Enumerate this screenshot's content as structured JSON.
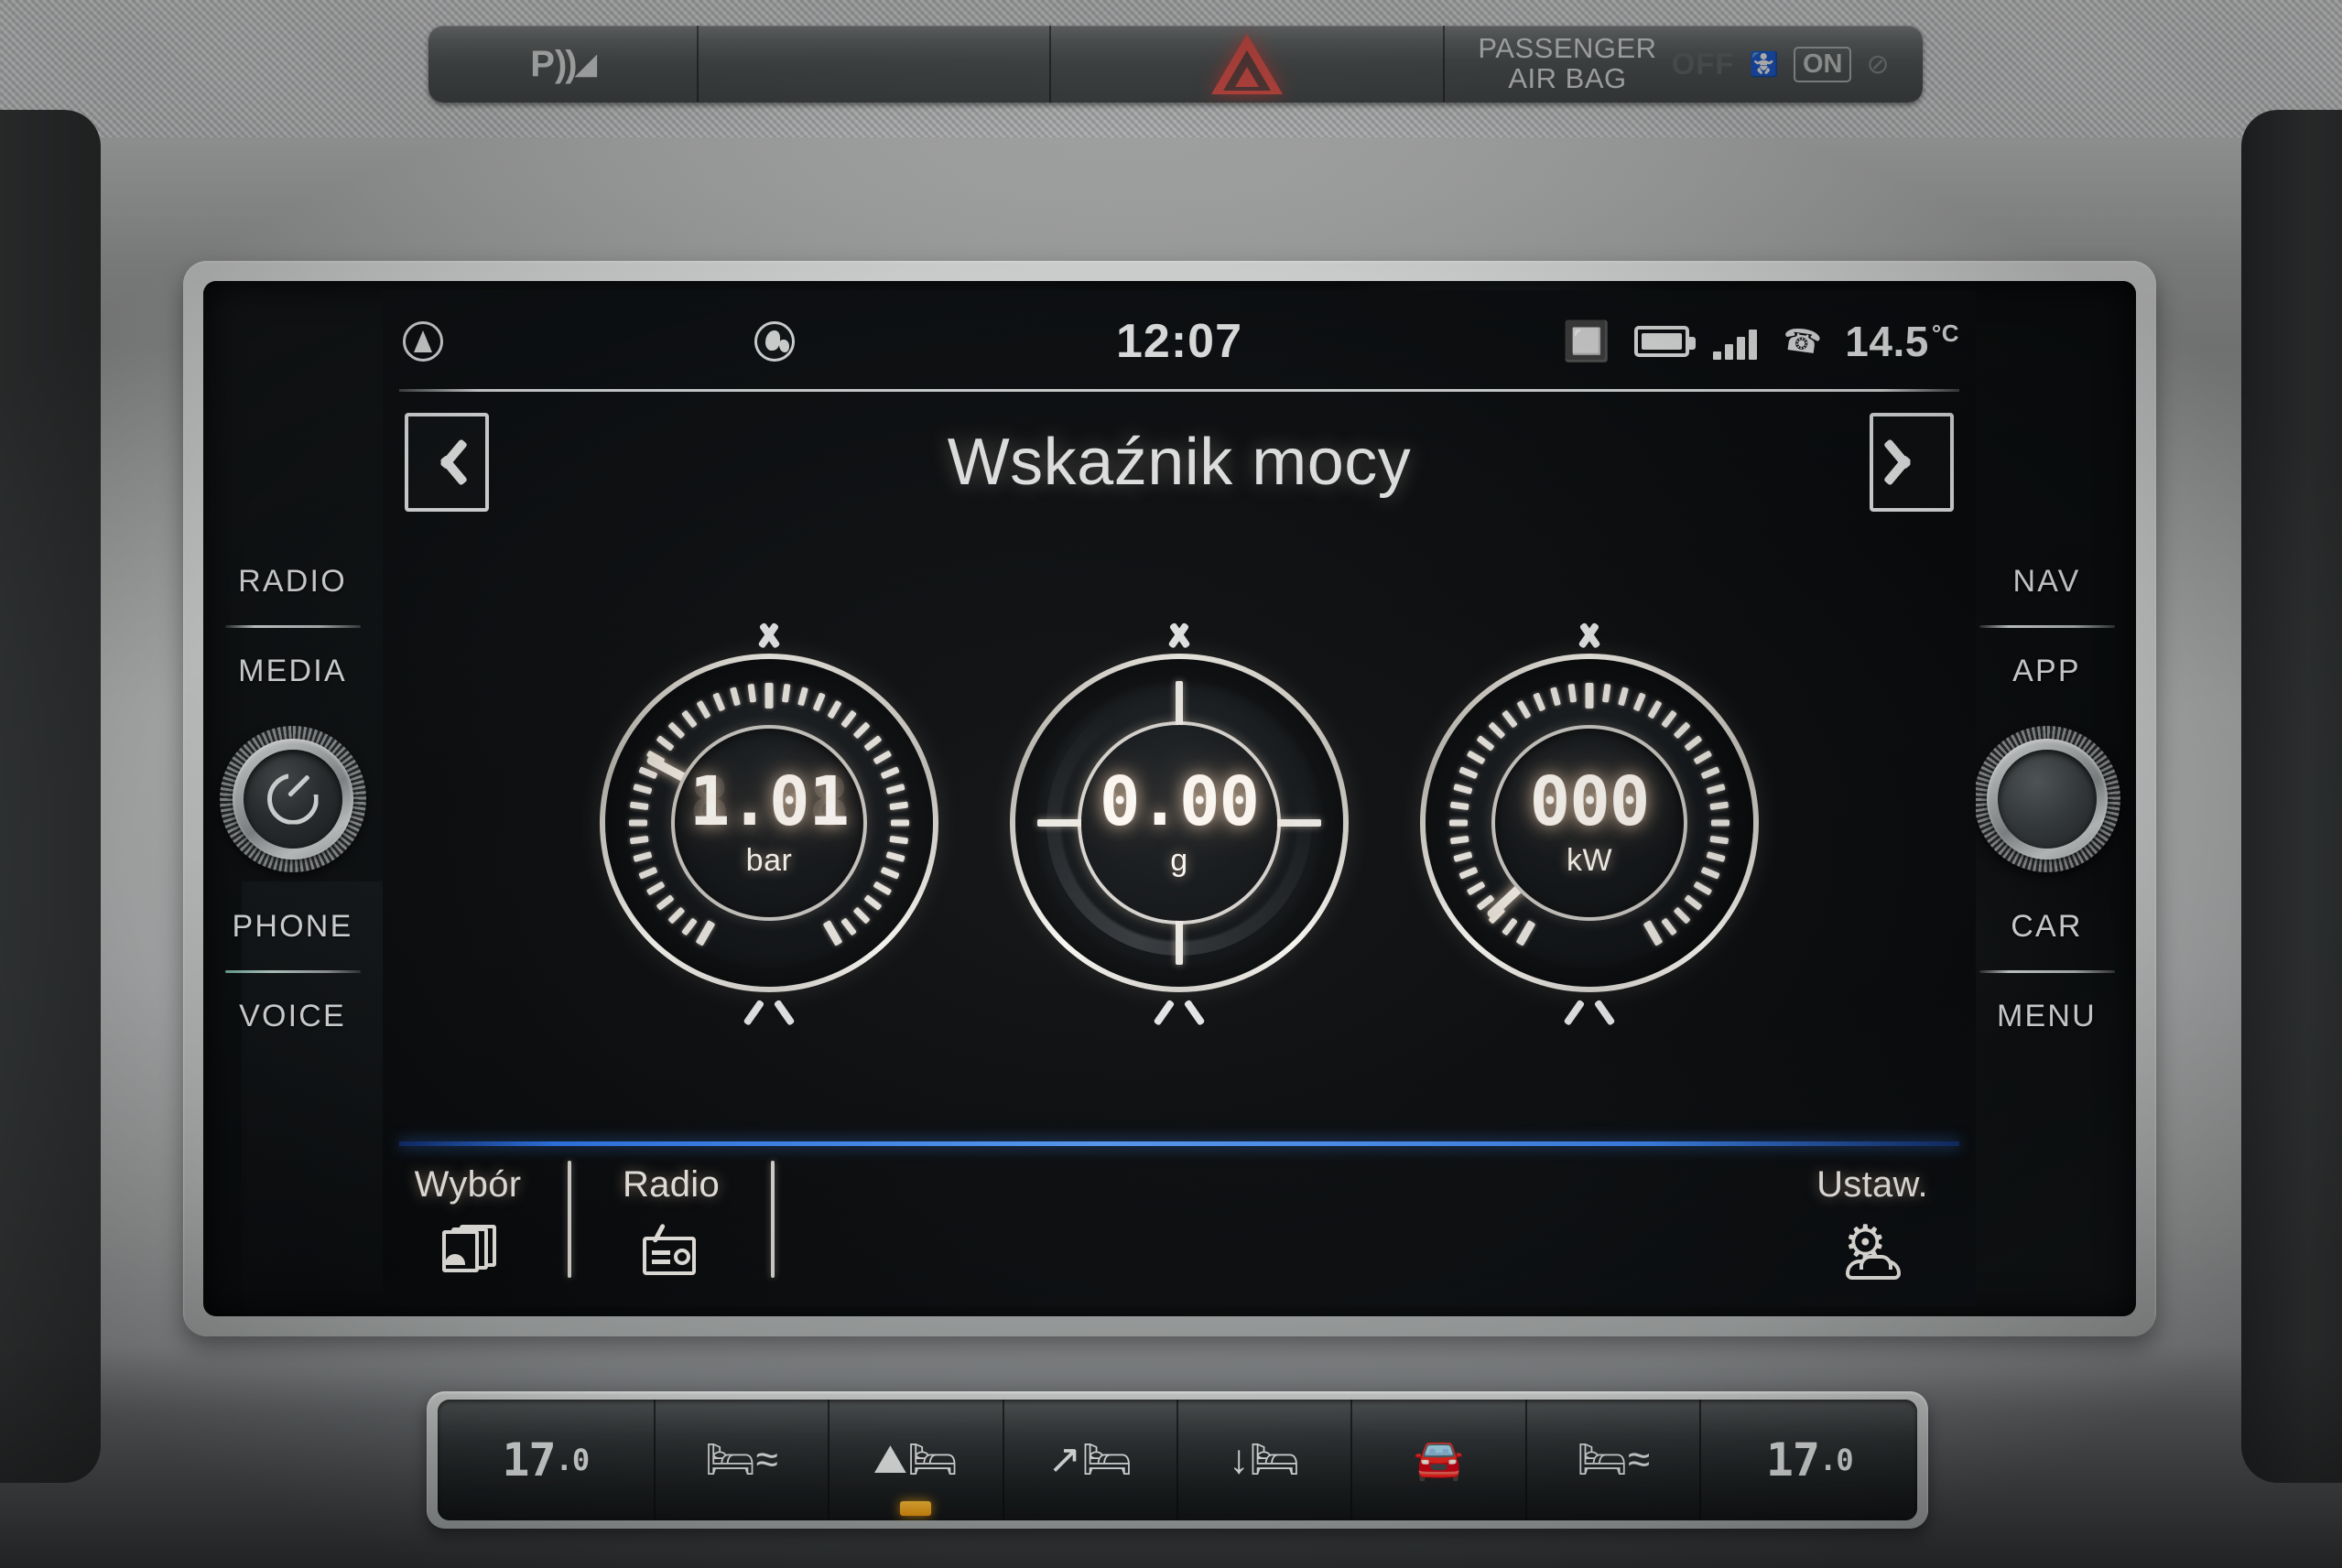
{
  "hardkeys": {
    "left": [
      {
        "label": "RADIO",
        "name": "radio"
      },
      {
        "label": "MEDIA",
        "name": "media"
      },
      {
        "label": "PHONE",
        "name": "phone"
      },
      {
        "label": "VOICE",
        "name": "voice"
      }
    ],
    "right": [
      {
        "label": "NAV",
        "name": "nav"
      },
      {
        "label": "APP",
        "name": "app"
      },
      {
        "label": "CAR",
        "name": "car"
      },
      {
        "label": "MENU",
        "name": "menu"
      }
    ]
  },
  "topbar": {
    "parking_icon": "parking-distance-icon",
    "hazard_icon": "hazard-triangle-icon",
    "airbag_line1": "PASSENGER",
    "airbag_line2": "AIR BAG",
    "airbag_off": "OFF",
    "airbag_on": "ON"
  },
  "statusbar": {
    "nav_icon": "compass-arrow-icon",
    "globe_icon": "globe-icon",
    "clock": "12:07",
    "bluetooth_icon": "bluetooth-icon",
    "battery_icon": "battery-icon",
    "signal_icon": "signal-bars-icon",
    "phone_icon": "phone-handset-icon",
    "outside_temp": "14.5",
    "temp_unit": "°C"
  },
  "header": {
    "title": "Wskaźnik mocy",
    "prev_label": "prev-view",
    "next_label": "next-view"
  },
  "chart_data": {
    "type": "gauge-cluster",
    "title": "Wskaźnik mocy",
    "gauges": [
      {
        "id": "boost",
        "value": "1.01",
        "unit": "bar",
        "needle_deg": -62,
        "style": "ticked-dial",
        "ghost": "8.88"
      },
      {
        "id": "gforce",
        "value": "0.00",
        "unit": "g",
        "needle_deg": 0,
        "style": "crosshair",
        "ghost": "8.88"
      },
      {
        "id": "power",
        "value": "000",
        "unit": "kW",
        "needle_deg": -133,
        "style": "ticked-dial",
        "ghost": "888"
      }
    ]
  },
  "toolbar": {
    "select_label": "Wybór",
    "select_icon": "card-stack-icon",
    "radio_label": "Radio",
    "radio_icon": "radio-icon",
    "settings_label": "Ustaw.",
    "settings_icon": "settings-gear-car-icon"
  },
  "climate": {
    "left_temp_int": "17",
    "left_temp_dec": ".0",
    "right_temp_int": "17",
    "right_temp_dec": ".0",
    "buttons": [
      {
        "name": "seat-heat-left",
        "glyph": "≋"
      },
      {
        "name": "windshield-defrost",
        "glyph": "⩚"
      },
      {
        "name": "face-vent",
        "glyph": "↗"
      },
      {
        "name": "foot-vent",
        "glyph": "↓"
      },
      {
        "name": "air-recirculation",
        "glyph": "⌒"
      },
      {
        "name": "seat-heat-right",
        "glyph": "≋"
      }
    ]
  },
  "colors": {
    "accent_blue": "#3c86f2",
    "hazard_red": "#f05a52",
    "led_amber": "#f09a10",
    "lcd_text": "#fffdf8"
  }
}
